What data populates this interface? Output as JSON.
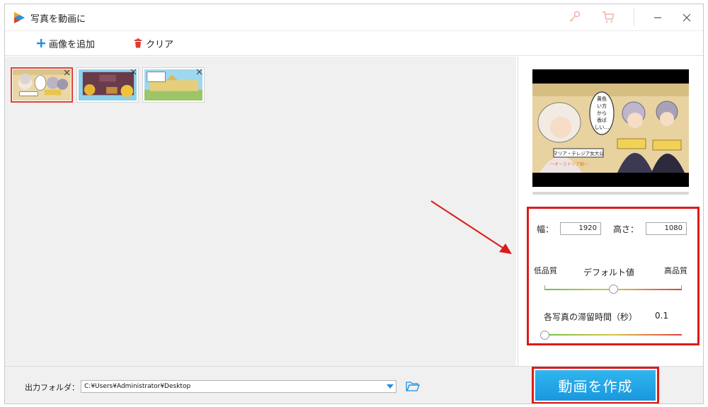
{
  "window": {
    "title": "写真を動画に"
  },
  "toolbar": {
    "add_images_label": "画像を追加",
    "clear_label": "クリア"
  },
  "image_list": {
    "items": [
      {
        "name": "thumb-1",
        "selected": true
      },
      {
        "name": "thumb-2",
        "selected": false
      },
      {
        "name": "thumb-3",
        "selected": false
      }
    ]
  },
  "preview": {
    "speech_bubble": "黄色い方から香ばしい匂い…",
    "caption": "マリア・テレジア女大公",
    "sub_caption": "～オーストリア編～"
  },
  "settings": {
    "width_label": "幅：",
    "width_value": "1920",
    "height_label": "高さ：",
    "height_value": "1080",
    "quality_low_label": "低品質",
    "quality_default_label": "デフォルト値",
    "quality_high_label": "高品質",
    "quality_level": 0.5,
    "duration_label": "各写真の滞留時間（秒）",
    "duration_value": "0.1",
    "duration_level": 0.0
  },
  "bottom": {
    "output_folder_label": "出力フォルダ：",
    "output_path": "C:¥Users¥Administrator¥Desktop",
    "create_button_label": "動画を作成"
  },
  "colors": {
    "accent_blue": "#1ea1e6",
    "highlight_red": "#dd1a1a"
  }
}
